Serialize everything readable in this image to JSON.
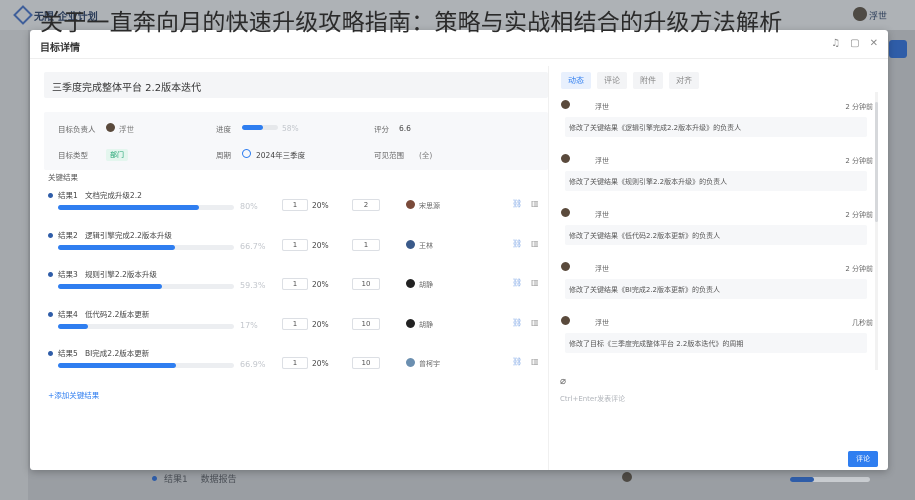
{
  "overlay_title": "关于一直奔向月的快速升级攻略指南：策略与实战相结合的升级方法解析",
  "background": {
    "app_name": "无限·企业计划",
    "user_name": "浮世",
    "bottom_kr_name": "结果1",
    "bottom_kr_label": "数据报告"
  },
  "modal": {
    "title": "目标详情",
    "objective_title": "三季度完成整体平台 2.2版本迭代",
    "info": {
      "owner_label": "目标负责人",
      "owner_value": "浮世",
      "progress_label": "进度",
      "progress_value": "58%",
      "progress_fraction": 0.58,
      "score_label": "评分",
      "score_value": "6.6",
      "type_label": "目标类型",
      "type_value": "部门",
      "period_label": "周期",
      "period_value": "2024年三季度",
      "visibility_label": "可见范围",
      "visibility_value": "(全)"
    },
    "kr_section_label": "关键结果",
    "key_results": [
      {
        "code": "结果1",
        "name": "文档完成升级2.2",
        "progress_text": "80%",
        "progress": 0.8,
        "weight_value": "1",
        "weight_pct": "20%",
        "confidence": "2",
        "owner": "宋思源"
      },
      {
        "code": "结果2",
        "name": "逻辑引擎完成2.2版本升级",
        "progress_text": "66.7%",
        "progress": 0.667,
        "weight_value": "1",
        "weight_pct": "20%",
        "confidence": "1",
        "owner": "王林"
      },
      {
        "code": "结果3",
        "name": "规则引擎2.2版本升级",
        "progress_text": "59.3%",
        "progress": 0.593,
        "weight_value": "1",
        "weight_pct": "20%",
        "confidence": "10",
        "owner": "胡静"
      },
      {
        "code": "结果4",
        "name": "低代码2.2版本更新",
        "progress_text": "17%",
        "progress": 0.17,
        "weight_value": "1",
        "weight_pct": "20%",
        "confidence": "10",
        "owner": "胡静"
      },
      {
        "code": "结果5",
        "name": "BI完成2.2版本更新",
        "progress_text": "66.9%",
        "progress": 0.669,
        "weight_value": "1",
        "weight_pct": "20%",
        "confidence": "10",
        "owner": "曾柯宇"
      }
    ],
    "add_kr_label": "+添加关键结果",
    "tabs": [
      "动态",
      "评论",
      "附件",
      "对齐"
    ],
    "activities": [
      {
        "user": "浮世",
        "time": "2 分钟前",
        "message": "修改了关键结果《逻辑引擎完成2.2版本升级》的负责人"
      },
      {
        "user": "浮世",
        "time": "2 分钟前",
        "message": "修改了关键结果《规则引擎2.2版本升级》的负责人"
      },
      {
        "user": "浮世",
        "time": "2 分钟前",
        "message": "修改了关键结果《低代码2.2版本更新》的负责人"
      },
      {
        "user": "浮世",
        "time": "2 分钟前",
        "message": "修改了关键结果《BI完成2.2版本更新》的负责人"
      },
      {
        "user": "浮世",
        "time": "几秒前",
        "message": "修改了目标《三季度完成整体平台 2.2版本迭代》的周期"
      }
    ],
    "comment_placeholder": "Ctrl+Enter发表评论",
    "comment_button": "评论"
  },
  "colors": {
    "accent": "#2f7ef0",
    "brand_dark": "#2f5da8"
  }
}
